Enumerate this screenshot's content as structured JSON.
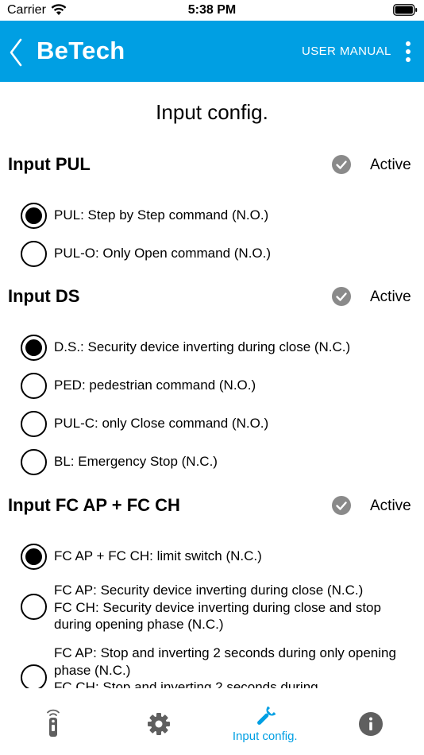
{
  "status_bar": {
    "carrier": "Carrier",
    "time": "5:38 PM"
  },
  "app_bar": {
    "title": "BeTech",
    "user_manual": "USER MANUAL"
  },
  "page_title": "Input config.",
  "sections": [
    {
      "title": "Input PUL",
      "status": "Active",
      "options": [
        {
          "label": "PUL: Step by Step command (N.O.)",
          "selected": true
        },
        {
          "label": "PUL-O: Only Open command (N.O.)",
          "selected": false
        }
      ]
    },
    {
      "title": "Input DS",
      "status": "Active",
      "options": [
        {
          "label": "D.S.: Security device inverting during close (N.C.)",
          "selected": true
        },
        {
          "label": "PED: pedestrian command (N.O.)",
          "selected": false
        },
        {
          "label": "PUL-C: only Close command (N.O.)",
          "selected": false
        },
        {
          "label": "BL: Emergency Stop (N.C.)",
          "selected": false
        }
      ]
    },
    {
      "title": "Input FC AP + FC CH",
      "status": "Active",
      "options": [
        {
          "label": "FC AP + FC CH: limit switch (N.C.)",
          "selected": true
        },
        {
          "label": "FC AP: Security device inverting during close (N.C.)\nFC CH: Security device inverting during close and stop during opening phase (N.C.)",
          "selected": false
        },
        {
          "label": "FC AP: Stop and inverting 2 seconds during only opening phase (N.C.)\nFC CH: Stop and inverting 2 seconds during",
          "selected": false
        }
      ]
    }
  ],
  "tab_bar": {
    "tabs": [
      {
        "name": "remote-icon",
        "label": ""
      },
      {
        "name": "gear-icon",
        "label": ""
      },
      {
        "name": "wrench-icon",
        "label": "Input config.",
        "active": true
      },
      {
        "name": "info-icon",
        "label": ""
      }
    ]
  },
  "colors": {
    "accent": "#009fe3",
    "check_gray": "#8a8a8a",
    "icon_gray": "#5f5f5f"
  }
}
